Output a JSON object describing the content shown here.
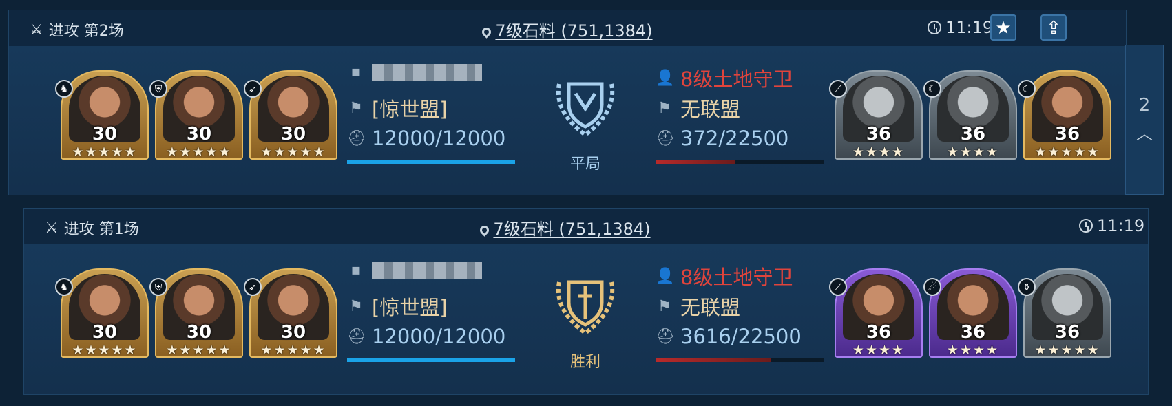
{
  "reports": [
    {
      "header": {
        "title": "进攻 第2场",
        "location": "7级石料 (751,1384)",
        "time": "11:19"
      },
      "attacker": {
        "heroes": [
          {
            "level": "30",
            "stars": "★★★★★",
            "frame": "gold",
            "badge": "horse-icon"
          },
          {
            "level": "30",
            "stars": "★★★★★",
            "frame": "gold",
            "badge": "shield-icon"
          },
          {
            "level": "30",
            "stars": "★★★★★",
            "frame": "gold",
            "badge": "bow-icon"
          }
        ],
        "alliance": "[惊世盟]",
        "troops": "12000/12000",
        "troop_ratio": 1.0
      },
      "result": {
        "label": "平局",
        "color": "#a9d0ef"
      },
      "defender": {
        "name": "8级土地守卫",
        "alliance": "无联盟",
        "troops": "372/22500",
        "troop_ratio": 0.47,
        "heroes": [
          {
            "level": "36",
            "stars": "★★★★",
            "frame": "grey",
            "badge": "spear-icon"
          },
          {
            "level": "36",
            "stars": "★★★★",
            "frame": "grey",
            "badge": "claw-icon"
          },
          {
            "level": "36",
            "stars": "★★★★★",
            "frame": "gold",
            "badge": "claw-icon"
          }
        ]
      }
    },
    {
      "header": {
        "title": "进攻 第1场",
        "location": "7级石料 (751,1384)",
        "time": "11:19"
      },
      "attacker": {
        "heroes": [
          {
            "level": "30",
            "stars": "★★★★★",
            "frame": "gold",
            "badge": "horse-icon"
          },
          {
            "level": "30",
            "stars": "★★★★★",
            "frame": "gold",
            "badge": "shield-icon"
          },
          {
            "level": "30",
            "stars": "★★★★★",
            "frame": "gold",
            "badge": "bow-icon"
          }
        ],
        "alliance": "[惊世盟]",
        "troops": "12000/12000",
        "troop_ratio": 1.0
      },
      "result": {
        "label": "胜利",
        "color": "#e6c27a"
      },
      "defender": {
        "name": "8级土地守卫",
        "alliance": "无联盟",
        "troops": "3616/22500",
        "troop_ratio": 0.69,
        "heroes": [
          {
            "level": "36",
            "stars": "★★★★",
            "frame": "purple",
            "badge": "spear-icon"
          },
          {
            "level": "36",
            "stars": "★★★★",
            "frame": "purple",
            "badge": "cannon-icon"
          },
          {
            "level": "36",
            "stars": "★★★★★",
            "frame": "grey",
            "badge": "vase-icon"
          }
        ]
      }
    }
  ],
  "side_tab": {
    "count": "2"
  },
  "colors": {
    "attacker_bar": "#1aa3e8",
    "defender_bar": "#b82a2a",
    "defender_bar_dim": "#6b1c1c"
  }
}
